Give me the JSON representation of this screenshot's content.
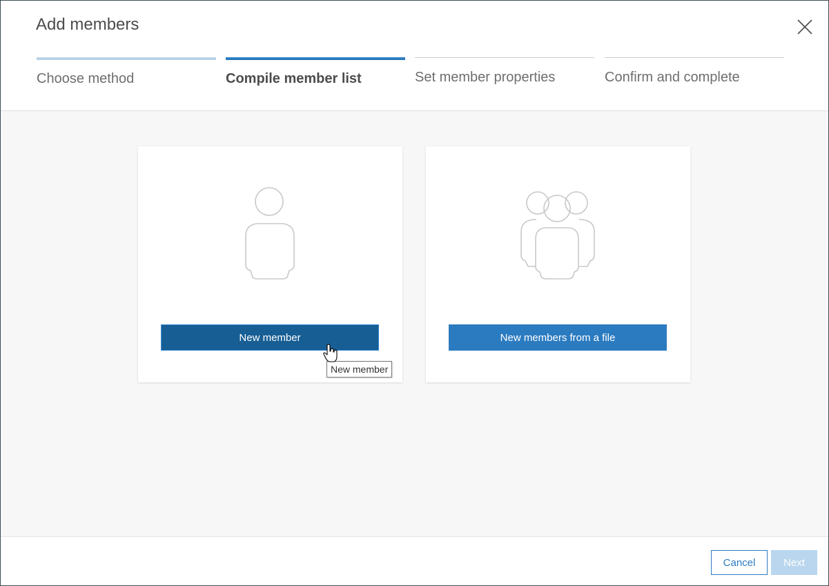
{
  "dialog": {
    "title": "Add members",
    "close_icon": "close-icon"
  },
  "steps": [
    {
      "label": "Choose method",
      "state": "done"
    },
    {
      "label": "Compile member list",
      "state": "current"
    },
    {
      "label": "Set member properties",
      "state": "future"
    },
    {
      "label": "Confirm and complete",
      "state": "future"
    }
  ],
  "options": [
    {
      "icon": "single-user-icon",
      "button_label": "New member",
      "state": "hover"
    },
    {
      "icon": "multiple-users-icon",
      "button_label": "New members from a file",
      "state": "normal"
    }
  ],
  "tooltip": {
    "text": "New member"
  },
  "footer": {
    "cancel_label": "Cancel",
    "next_label": "Next",
    "next_enabled": false
  },
  "colors": {
    "accent": "#2b7bc0",
    "accent_hover": "#175e94",
    "step_done": "#b8d3e8",
    "next_disabled": "#b9d6ee",
    "content_bg": "#f7f7f7"
  }
}
